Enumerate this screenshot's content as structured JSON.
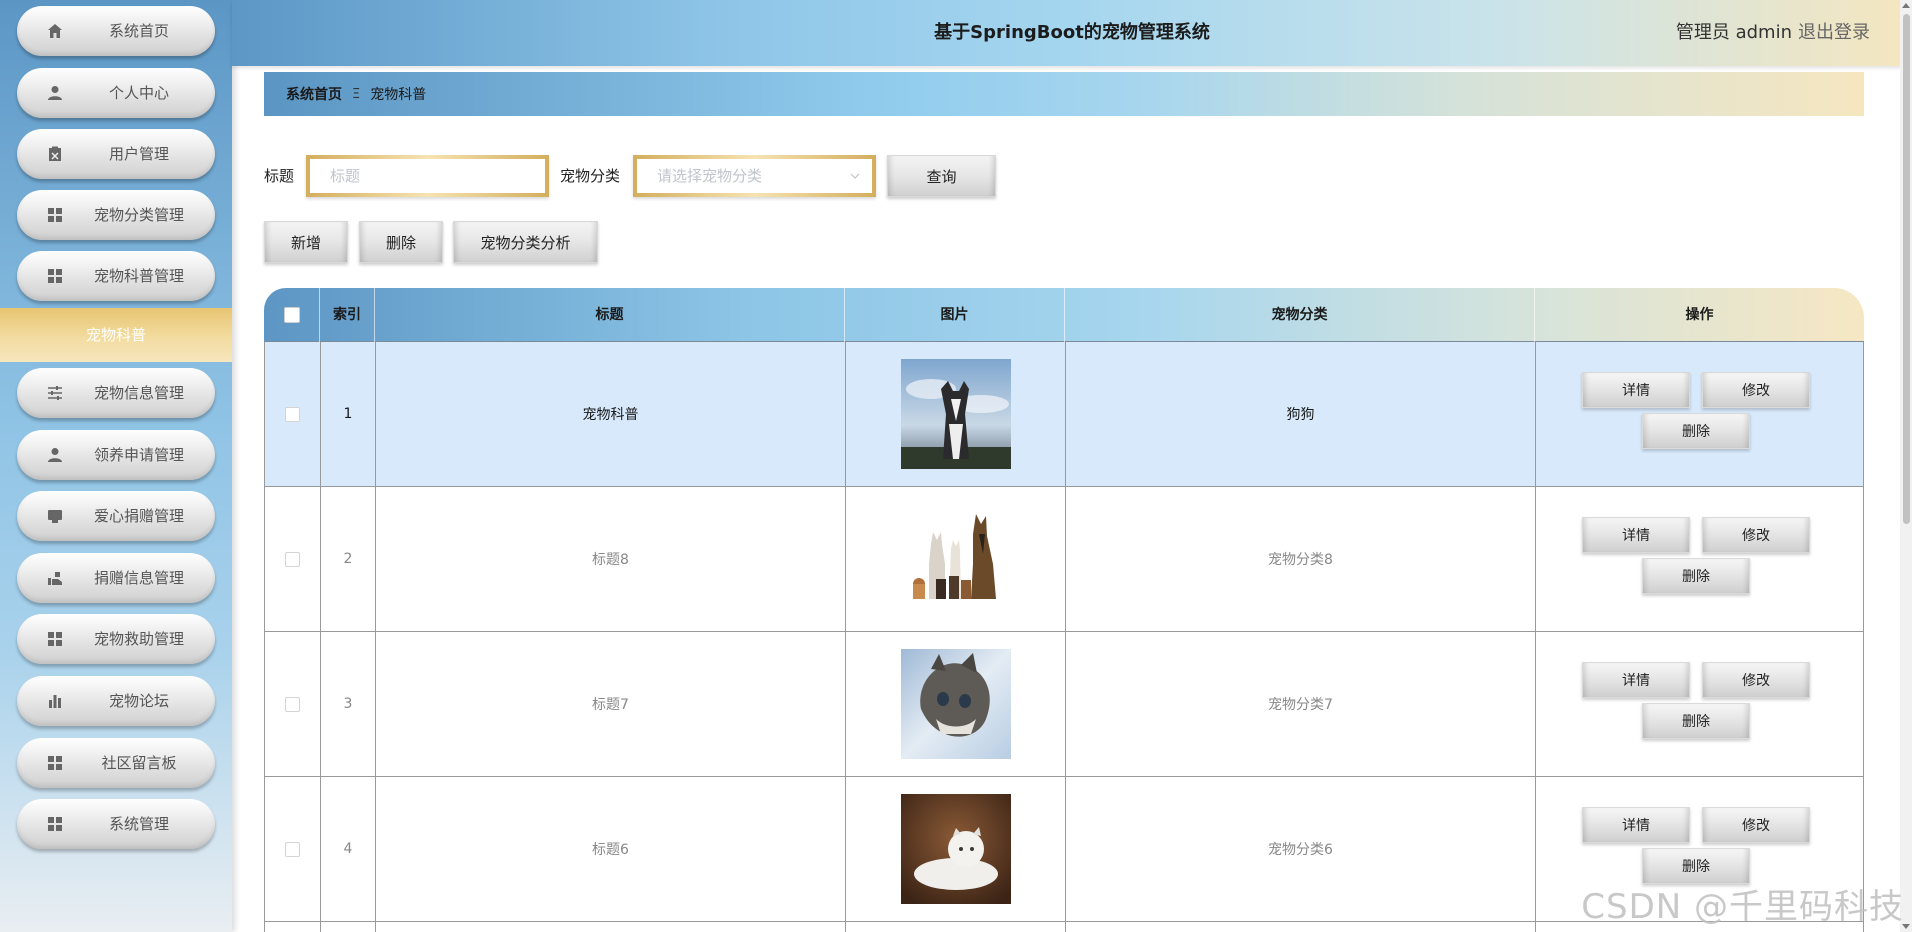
{
  "header": {
    "title": "基于SpringBoot的宠物管理系统",
    "user": "管理员 admin",
    "logout": "退出登录"
  },
  "sidebar": {
    "items": [
      {
        "label": "系统首页",
        "icon": "home-icon"
      },
      {
        "label": "个人中心",
        "icon": "user-icon"
      },
      {
        "label": "用户管理",
        "icon": "clipboard-icon"
      },
      {
        "label": "宠物分类管理",
        "icon": "grid-icon"
      },
      {
        "label": "宠物科普管理",
        "icon": "grid-icon"
      },
      {
        "label": "宠物信息管理",
        "icon": "sliders-icon"
      },
      {
        "label": "领养申请管理",
        "icon": "user-icon"
      },
      {
        "label": "爱心捐赠管理",
        "icon": "monitor-icon"
      },
      {
        "label": "捐赠信息管理",
        "icon": "hand-icon"
      },
      {
        "label": "宠物救助管理",
        "icon": "grid-icon"
      },
      {
        "label": "宠物论坛",
        "icon": "bar-chart-icon"
      },
      {
        "label": "社区留言板",
        "icon": "grid-icon"
      },
      {
        "label": "系统管理",
        "icon": "grid-icon"
      }
    ],
    "active_sub": "宠物科普"
  },
  "breadcrumb": {
    "home": "系统首页",
    "separator": "Ξ",
    "current": "宠物科普"
  },
  "search": {
    "title_label": "标题",
    "title_placeholder": "标题",
    "category_label": "宠物分类",
    "category_placeholder": "请选择宠物分类",
    "query_button": "查询"
  },
  "actions": {
    "add": "新增",
    "delete": "删除",
    "analysis": "宠物分类分析"
  },
  "table": {
    "columns": [
      "索引",
      "标题",
      "图片",
      "宠物分类",
      "操作"
    ],
    "rows": [
      {
        "index": "1",
        "title": "宠物科普",
        "category": "狗狗",
        "image": "husky-photo"
      },
      {
        "index": "2",
        "title": "标题8",
        "category": "宠物分类8",
        "image": "pets-group-photo"
      },
      {
        "index": "3",
        "title": "标题7",
        "category": "宠物分类7",
        "image": "kitten-photo"
      },
      {
        "index": "4",
        "title": "标题6",
        "category": "宠物分类6",
        "image": "white-cat-photo"
      }
    ],
    "ops": {
      "detail": "详情",
      "edit": "修改",
      "delete": "删除"
    }
  },
  "watermark": "CSDN @千里码科技",
  "colors": {
    "accent_blue": "#5b96c5",
    "accent_gold": "#e7c572",
    "row_highlight": "#d7e9fb"
  }
}
